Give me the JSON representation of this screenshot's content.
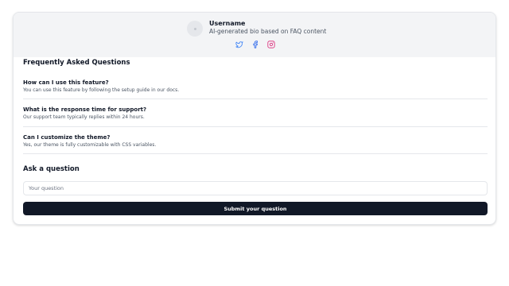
{
  "profile": {
    "username": "Username",
    "bio": "AI-generated bio based on FAQ content",
    "social_icons": [
      "twitter-icon",
      "facebook-icon",
      "instagram-icon"
    ],
    "colors": {
      "twitter": "#3b82f6",
      "facebook": "#2563eb",
      "instagram": "#db2777"
    }
  },
  "faq": {
    "title": "Frequently Asked Questions",
    "items": [
      {
        "question": "How can I use this feature?",
        "answer": "You can use this feature by following the setup guide in our docs."
      },
      {
        "question": "What is the response time for support?",
        "answer": "Our support team typically replies within 24 hours."
      },
      {
        "question": "Can I customize the theme?",
        "answer": "Yes, our theme is fully customizable with CSS variables."
      }
    ]
  },
  "ask": {
    "title": "Ask a question",
    "placeholder": "Your question",
    "value": "",
    "submit_label": "Submit your question"
  },
  "colors": {
    "header_bg": "#f3f4f6",
    "button_bg": "#111827",
    "border": "#e5e7eb"
  }
}
